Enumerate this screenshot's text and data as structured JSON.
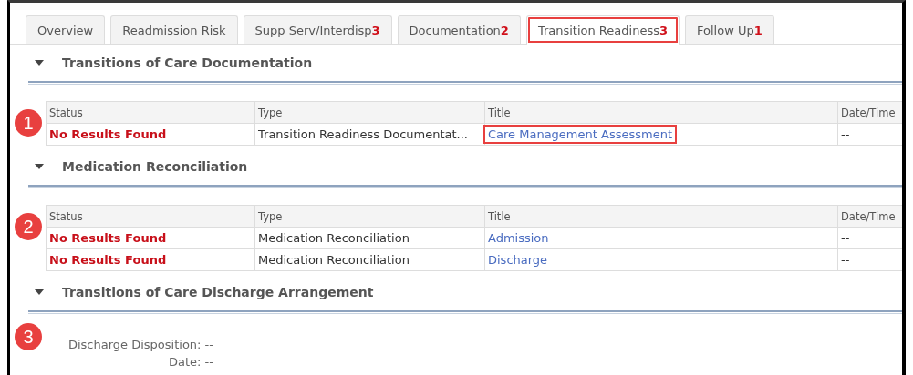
{
  "tabs": [
    {
      "label": "Overview",
      "selected": false,
      "highlighted": false
    },
    {
      "label": "Readmission Risk",
      "selected": false,
      "highlighted": false
    },
    {
      "label": "Supp Serv/Interdisp",
      "count": "3",
      "selected": false,
      "highlighted": false
    },
    {
      "label": "Documentation",
      "count": "2",
      "selected": false,
      "highlighted": false
    },
    {
      "label": "Transition Readiness",
      "count": "3",
      "selected": true,
      "highlighted": true
    },
    {
      "label": "Follow Up",
      "count": "1",
      "selected": false,
      "highlighted": false
    }
  ],
  "sections": [
    {
      "title": "Transitions of Care Documentation",
      "expanded": true,
      "kind": "table",
      "callout": "1",
      "columns": [
        "Status",
        "Type",
        "Title",
        "Date/Time"
      ],
      "rows": [
        {
          "status": "No Results Found",
          "type": "Transition Readiness Documentat...",
          "title": "Care Management Assessment",
          "highlighted": true,
          "date_time": "--"
        }
      ]
    },
    {
      "title": "Medication Reconciliation",
      "expanded": true,
      "kind": "table",
      "callout": "2",
      "columns": [
        "Status",
        "Type",
        "Title",
        "Date/Time"
      ],
      "rows": [
        {
          "status": "No Results Found",
          "type": "Medication Reconciliation",
          "title": "Admission",
          "highlighted": false,
          "date_time": "--"
        },
        {
          "status": "No Results Found",
          "type": "Medication Reconciliation",
          "title": "Discharge",
          "highlighted": false,
          "date_time": "--"
        }
      ]
    },
    {
      "title": "Transitions of Care Discharge Arrangement",
      "expanded": true,
      "kind": "fields",
      "callout": "3",
      "field_lines": [
        "Discharge Disposition: --",
        "Date: --"
      ]
    }
  ]
}
